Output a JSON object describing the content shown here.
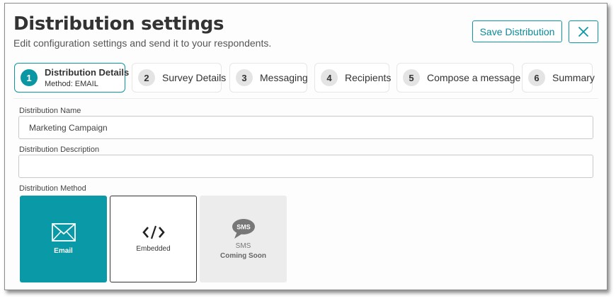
{
  "header": {
    "title": "Distribution settings",
    "subtitle": "Edit configuration settings and send it to your respondents.",
    "save_label": "Save Distribution"
  },
  "steps": [
    {
      "num": "1",
      "label": "Distribution Details",
      "sub": "Method: EMAIL",
      "active": true
    },
    {
      "num": "2",
      "label": "Survey Details"
    },
    {
      "num": "3",
      "label": "Messaging"
    },
    {
      "num": "4",
      "label": "Recipients"
    },
    {
      "num": "5",
      "label": "Compose a message"
    },
    {
      "num": "6",
      "label": "Summary"
    }
  ],
  "form": {
    "name_label": "Distribution Name",
    "name_value": "Marketing Campaign",
    "description_label": "Distribution Description",
    "description_value": "",
    "method_label": "Distribution Method"
  },
  "methods": {
    "email": {
      "label": "Email",
      "icon": "envelope-icon",
      "selected": true
    },
    "embedded": {
      "label": "Embedded",
      "icon": "code-icon"
    },
    "sms": {
      "label": "SMS",
      "icon": "sms-bubble-icon",
      "badge": "SMS",
      "status": "Coming Soon"
    }
  },
  "colors": {
    "accent": "#0a96a3",
    "disabled_bg": "#ececec"
  }
}
